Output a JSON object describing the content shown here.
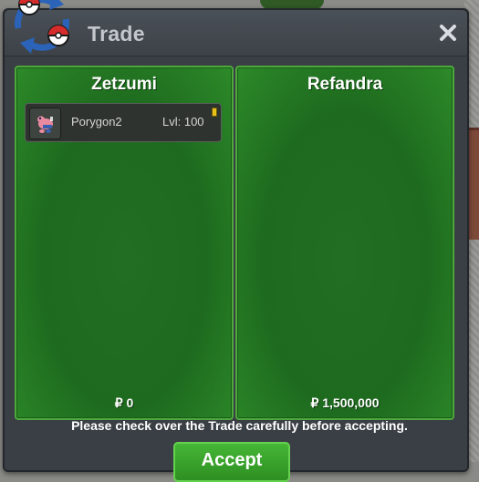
{
  "window": {
    "title": "Trade",
    "close_icon": "close-icon",
    "logo_icon": "trade-swap-pokeball-icon"
  },
  "left_panel": {
    "trainer_name": "Zetzumi",
    "money": "₽ 0",
    "items": [
      {
        "icon": "porygon2-icon",
        "name": "Porygon2",
        "level": "Lvl: 100"
      }
    ]
  },
  "right_panel": {
    "trainer_name": "Refandra",
    "money": "₽ 1,500,000",
    "items": []
  },
  "footer": {
    "notice": "Please check over the Trade carefully before accepting.",
    "accept_label": "Accept"
  },
  "colors": {
    "panel_green": "#1f6b20",
    "panel_border": "#4fa83e",
    "window_bg": "#3a3f45",
    "accept_green": "#3aa52d"
  }
}
